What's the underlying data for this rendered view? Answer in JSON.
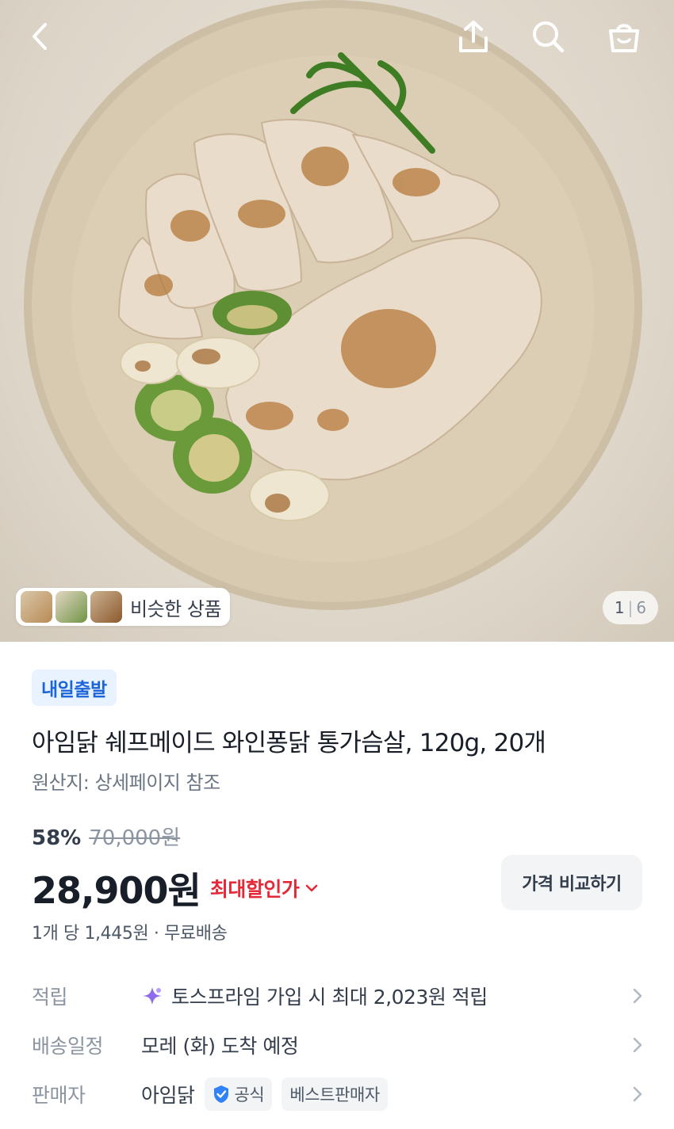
{
  "hero": {
    "similar_label": "비슷한 상품",
    "pager_current": "1",
    "pager_total": "6"
  },
  "icons": {
    "back": "back-arrow-icon",
    "share": "share-icon",
    "search": "search-icon",
    "cart": "shopping-bag-icon"
  },
  "product": {
    "badge": "내일출발",
    "title": "아임닭 쉐프메이드 와인퐁닭 통가슴살, 120g, 20개",
    "origin": "원산지: 상세페이지 참조",
    "discount_rate": "58%",
    "original_price": "70,000원",
    "price": "28,900원",
    "max_discount_label": "최대할인가",
    "compare_button": "가격 비교하기",
    "unit_price": "1개 당 1,445원",
    "shipping": "무료배송"
  },
  "details": {
    "reward_key": "적립",
    "reward_value": "토스프라임 가입 시 최대 2,023원 적립",
    "delivery_key": "배송일정",
    "delivery_value": "모레 (화) 도착 예정",
    "seller_key": "판매자",
    "seller_name": "아임닭",
    "official_tag": "공식",
    "best_seller_tag": "베스트판매자"
  },
  "colors": {
    "accent_blue": "#1b64da",
    "discount_red": "#e42939",
    "badge_bg": "#e8f3ff"
  }
}
